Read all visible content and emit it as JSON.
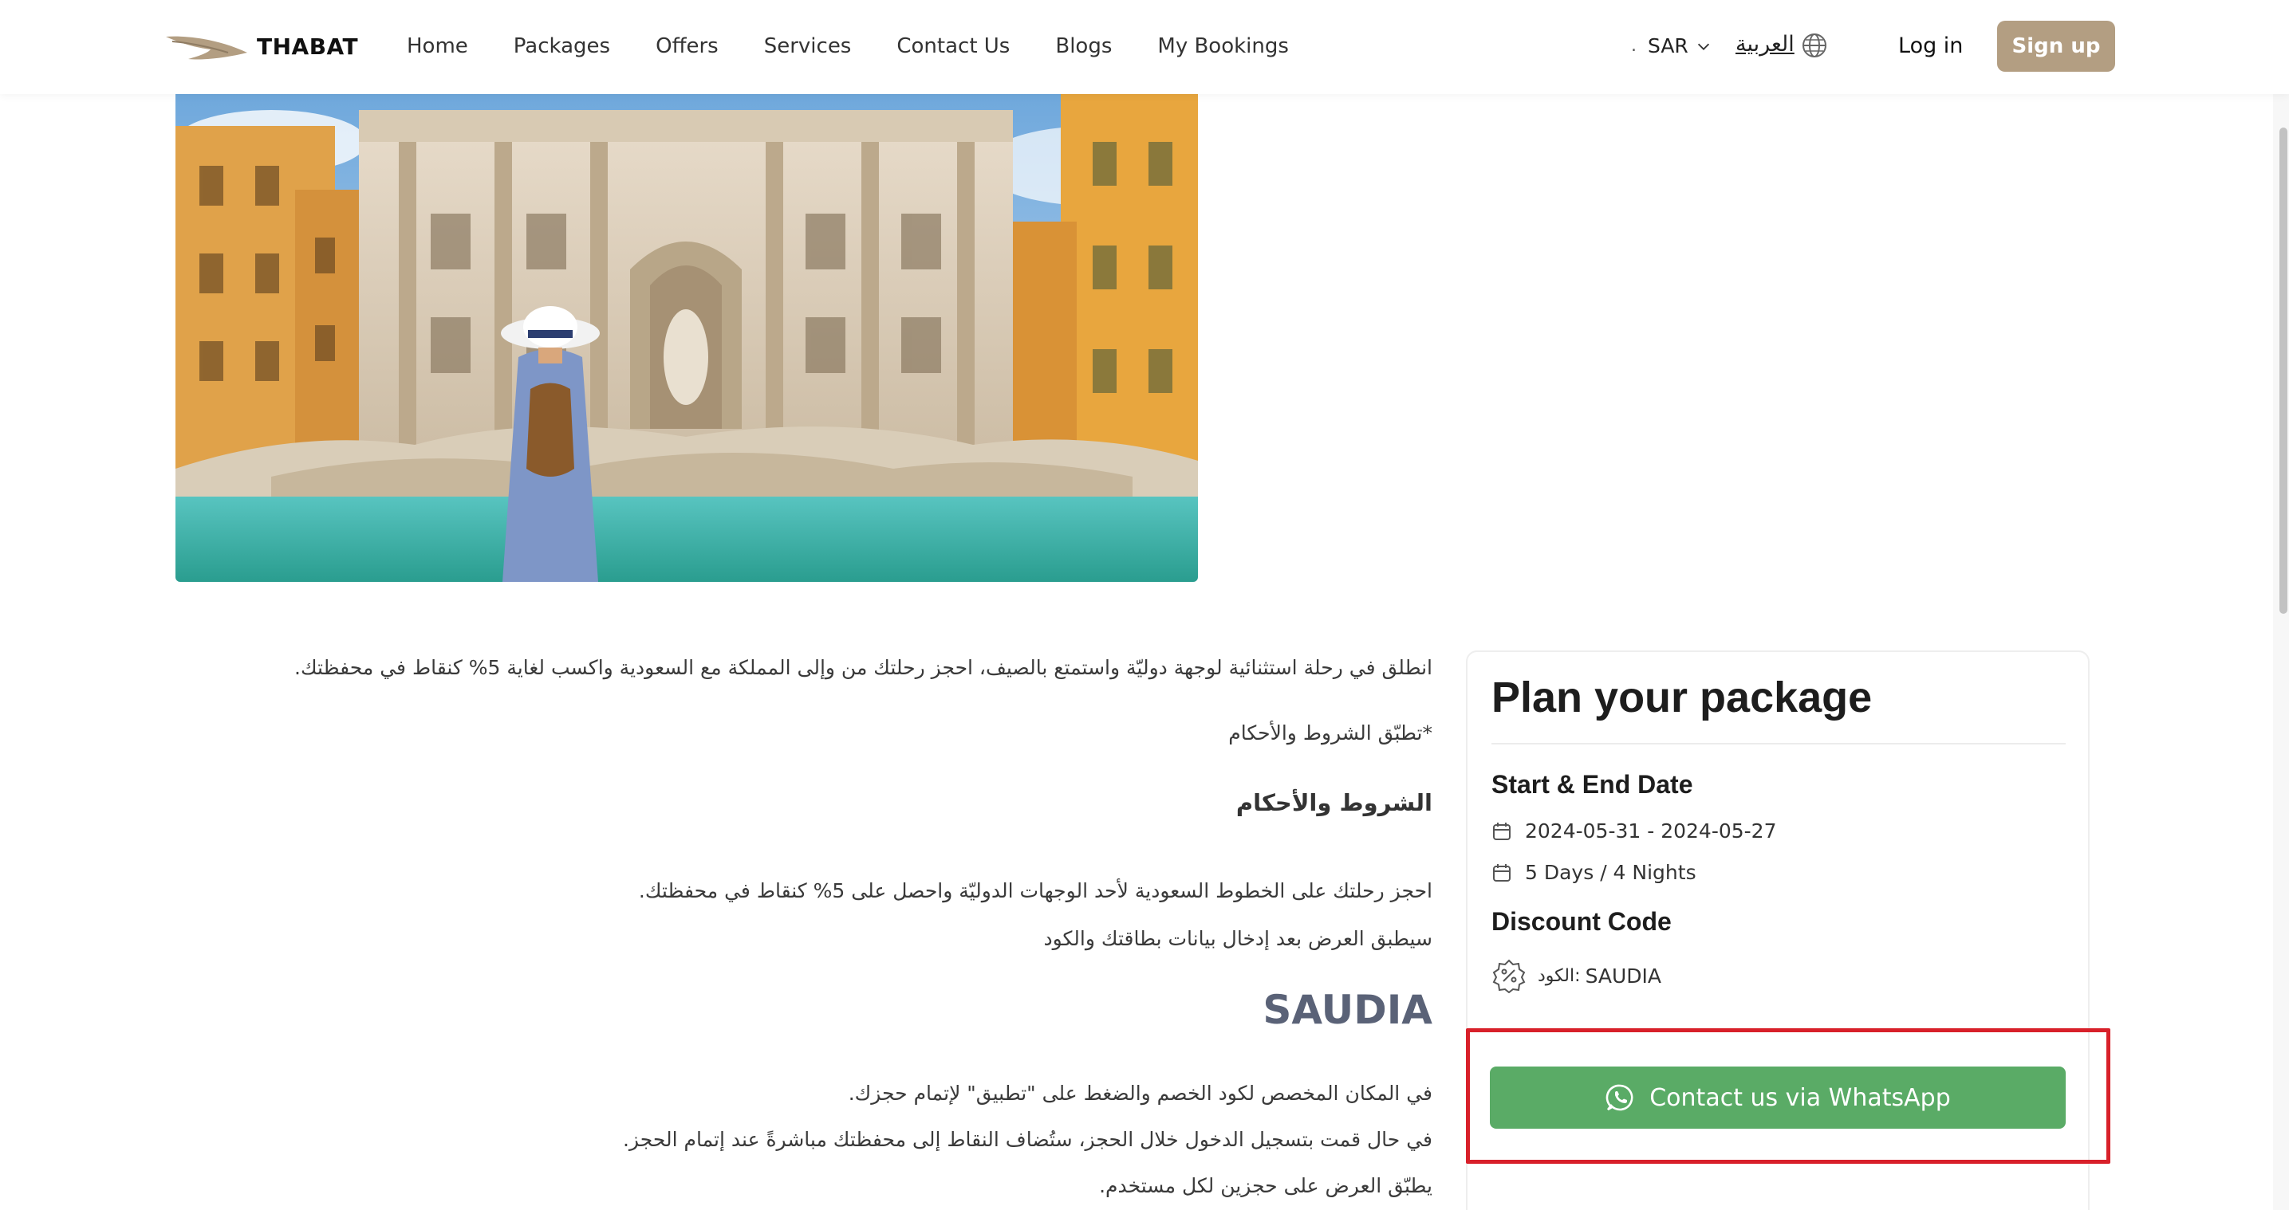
{
  "header": {
    "logo_text": "THABAT",
    "nav": [
      "Home",
      "Packages",
      "Offers",
      "Services",
      "Contact Us",
      "Blogs",
      "My Bookings"
    ],
    "currency_dot": ".",
    "currency": "SAR",
    "language": "العربية",
    "login": "Log in",
    "signup": "Sign up"
  },
  "hero": {
    "icon": "trevi-fountain-photo"
  },
  "description": {
    "p1": "انطلق في رحلة استثنائية لوجهة دوليّة واستمتع بالصيف، احجز رحلتك من وإلى المملكة مع السعودية واكسب لغاية 5% كنقاط في محفظتك.",
    "p2": "*تطبّق الشروط والأحكام",
    "terms_heading": "الشروط والأحكام",
    "p3": "احجز رحلتك على الخطوط السعودية لأحد الوجهات الدوليّة واحصل على 5% كنقاط في محفظتك.",
    "p4": "سيطبق العرض بعد إدخال بيانات بطاقتك والكود",
    "code_heading": "SAUDIA",
    "p5": "في المكان المخصص لكود الخصم والضغط على \"تطبيق\" لإتمام حجزك.",
    "p6": "في حال قمت بتسجيل الدخول خلال الحجز، ستُضاف النقاط إلى محفظتك مباشرةً عند إتمام الحجز.",
    "p7": "يطبّق العرض على حجزين لكل مستخدم."
  },
  "plan_card": {
    "title": "Plan your package",
    "dates_heading": "Start & End Date",
    "date_range": "2024-05-31 - 2024-05-27",
    "duration": "5 Days / 4 Nights",
    "discount_heading": "Discount Code",
    "discount_label": "الكود:",
    "discount_code": "SAUDIA",
    "whatsapp_button": "Contact us via WhatsApp"
  },
  "colors": {
    "signup_bg": "#b39e82",
    "whatsapp_green": "#5aab66",
    "highlight_red": "#d8202a",
    "saudia_heading": "#5a6277"
  }
}
